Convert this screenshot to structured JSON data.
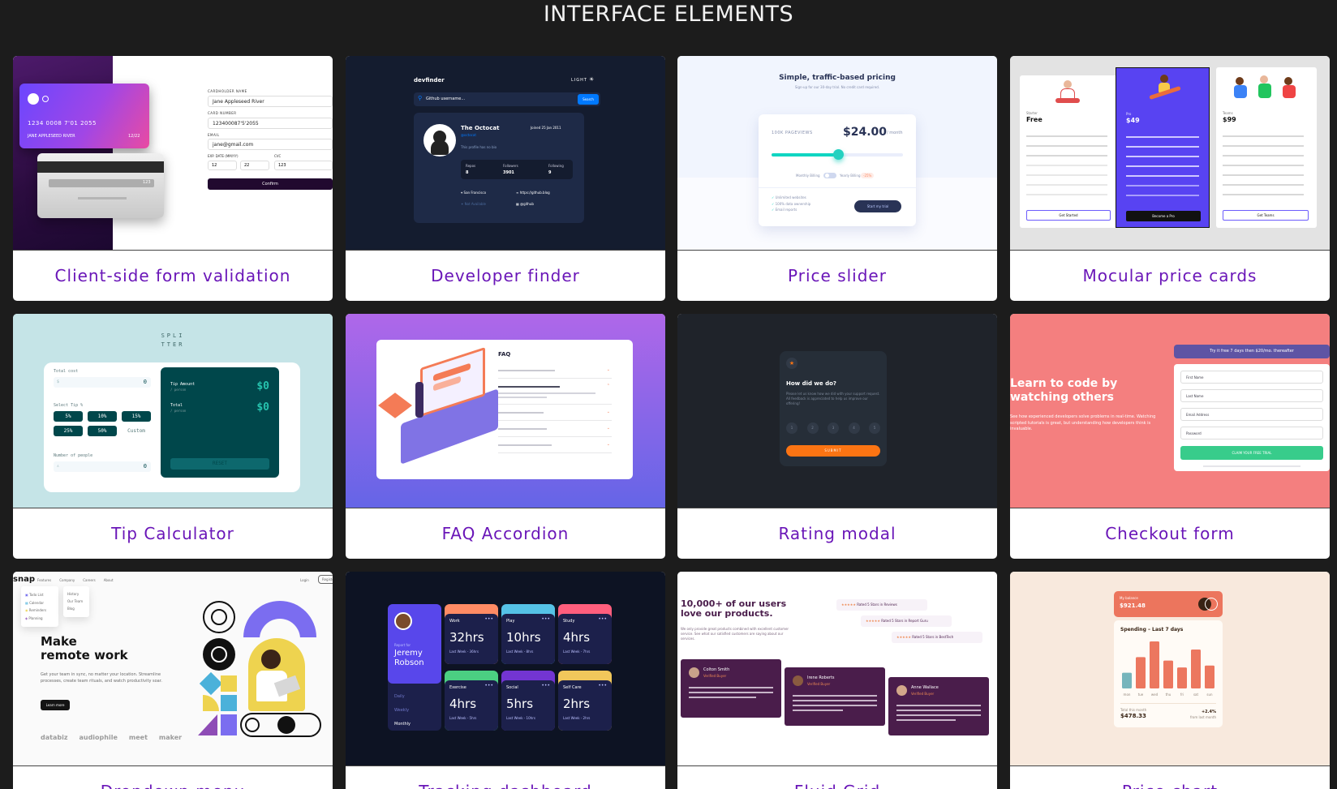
{
  "page": {
    "title": "INTERFACE ELEMENTS"
  },
  "cards": [
    {
      "label": "Client-side form validation",
      "preview": {
        "card_number": "1234 0008 7'01 2055",
        "card_holder": "JANE APPLESEED RIVER",
        "card_expiry": "12/22",
        "cvc": "123",
        "fields": [
          {
            "label": "CARDHOLDER NAME",
            "value": "Jane Appleseed River"
          },
          {
            "label": "CARD NUMBER",
            "value": "123400087'5'2055"
          },
          {
            "label": "EMAIL",
            "value": "jane@gmail.com"
          }
        ],
        "exp_label": "EXP. DATE (MM/YY)",
        "cvc_label": "CVC",
        "exp_mm": "12",
        "exp_yy": "22",
        "cvc_value": "123",
        "button": "Confirm"
      }
    },
    {
      "label": "Developer finder",
      "preview": {
        "logo": "devfinder",
        "theme": "LIGHT",
        "search_placeholder": "Github username...",
        "search_button": "Search",
        "name": "The Octocat",
        "joined": "Joined 25 Jan 2011",
        "handle": "@octocat",
        "bio": "This profile has no bio",
        "stats": [
          {
            "k": "Repos",
            "v": "8"
          },
          {
            "k": "Followers",
            "v": "3901"
          },
          {
            "k": "Following",
            "v": "9"
          }
        ],
        "links": [
          "San Francisco",
          "https://github.blog",
          "Not Available",
          "@github"
        ]
      }
    },
    {
      "label": "Price slider",
      "preview": {
        "heading": "Simple, traffic-based pricing",
        "sub": "Sign-up for our 30-day trial. No credit card required.",
        "pageviews": "100K PAGEVIEWS",
        "price": "$24.00",
        "per": "/ month",
        "billing_monthly": "Monthly Billing",
        "billing_yearly": "Yearly Billing",
        "discount": "-25%",
        "features": [
          "Unlimited websites",
          "100% data ownership",
          "Email reports"
        ],
        "cta": "Start my trial"
      }
    },
    {
      "label": "Mocular price cards",
      "preview": {
        "plans": [
          {
            "tag": "Starter",
            "name": "Free",
            "cta": "Get Started"
          },
          {
            "tag": "Pro",
            "name": "$49",
            "cta": "Become a Pro"
          },
          {
            "tag": "Teams",
            "name": "$99",
            "cta": "Get Teams"
          }
        ]
      }
    },
    {
      "label": "Tip Calculator",
      "preview": {
        "logo1": "SPLI",
        "logo2": "TTER",
        "bill_label": "Total cost",
        "bill_value": "0",
        "tip_label": "Select Tip %",
        "tips": [
          "5%",
          "10%",
          "15%",
          "25%",
          "50%"
        ],
        "custom": "Custom",
        "people_label": "Number of people",
        "people_value": "0",
        "tip_amount": "Tip Amount",
        "total": "Total",
        "per_person": "/ person",
        "tip_value": "$0",
        "total_value": "$0",
        "reset": "RESET"
      }
    },
    {
      "label": "FAQ Accordion",
      "preview": {
        "heading": "FAQ",
        "rows": 6
      }
    },
    {
      "label": "Rating modal",
      "preview": {
        "question": "How did we do?",
        "body": "Please let us know how we did with your support request. All feedback is appreciated to help us improve our offering!",
        "ratings": [
          "1",
          "2",
          "3",
          "4",
          "5"
        ],
        "submit": "SUBMIT"
      }
    },
    {
      "label": "Checkout form",
      "preview": {
        "headline": "Learn to code by watching others",
        "body": "See how experienced developers solve problems in real-time. Watching scripted tutorials is great, but understanding how developers think is invaluable.",
        "trial": "Try it free 7 days then $20/mo. thereafter",
        "fields": [
          "First Name",
          "Last Name",
          "Email Address",
          "Password"
        ],
        "cta": "CLAIM YOUR FREE TRIAL"
      }
    },
    {
      "label": "Dropdown menu",
      "preview": {
        "logo": "snap",
        "nav": [
          "Features",
          "Company",
          "Careers",
          "About"
        ],
        "login": "Login",
        "register": "Register",
        "menu": [
          "Todo List",
          "Calendar",
          "Reminders",
          "Planning"
        ],
        "menu2": [
          "History",
          "Our Team",
          "Blog"
        ],
        "headline1": "Make",
        "headline2": "remote work",
        "body": "Get your team in sync, no matter your location. Streamline processes, create team rituals, and watch productivity soar.",
        "cta": "Learn more",
        "clients": [
          "databiz",
          "audiophile",
          "meet",
          "maker"
        ]
      }
    },
    {
      "label": "Tracking dashboard",
      "preview": {
        "report_for": "Report for",
        "name": "Jeremy Robson",
        "periods": [
          "Daily",
          "Weekly",
          "Monthly"
        ],
        "tiles": [
          {
            "t": "Work",
            "h": "32hrs",
            "l": "Last Week - 36hrs",
            "c": "#ff8b64"
          },
          {
            "t": "Play",
            "h": "10hrs",
            "l": "Last Week - 8hrs",
            "c": "#55c2e6"
          },
          {
            "t": "Study",
            "h": "4hrs",
            "l": "Last Week - 7hrs",
            "c": "#ff5e7d"
          },
          {
            "t": "Exercise",
            "h": "4hrs",
            "l": "Last Week - 5hrs",
            "c": "#4bcf82"
          },
          {
            "t": "Social",
            "h": "5hrs",
            "l": "Last Week - 10hrs",
            "c": "#7335d2"
          },
          {
            "t": "Self Care",
            "h": "2hrs",
            "l": "Last Week - 2hrs",
            "c": "#f1c75b"
          }
        ]
      }
    },
    {
      "label": "Fluid Grid",
      "preview": {
        "heading": "10,000+ of our users love our products.",
        "body": "We only provide great products combined with excellent customer service. See what our satisfied customers are saying about our services.",
        "ratings": [
          "Rated 5 Stars in Reviews",
          "Rated 5 Stars in Report Guru",
          "Rated 5 Stars in BestTech"
        ],
        "testimonials": [
          {
            "name": "Colton Smith",
            "role": "Verified Buyer"
          },
          {
            "name": "Irene Roberts",
            "role": "Verified Buyer"
          },
          {
            "name": "Anne Wallace",
            "role": "Verified Buyer"
          }
        ]
      }
    },
    {
      "label": "Price chart",
      "preview": {
        "balance_label": "My balance",
        "balance": "$921.48",
        "heading": "Spending – Last 7 days",
        "days": [
          "mon",
          "tue",
          "wed",
          "thu",
          "fri",
          "sat",
          "sun"
        ],
        "values": [
          17.45,
          34.91,
          52.36,
          31.07,
          23.39,
          43.28,
          25.48
        ],
        "month_label": "Total this month",
        "month_value": "$478.33",
        "delta": "+2.4%",
        "delta_label": "from last month",
        "colors": {
          "bar": "#ec775f",
          "bar_active": "#76b5bc"
        }
      }
    }
  ]
}
